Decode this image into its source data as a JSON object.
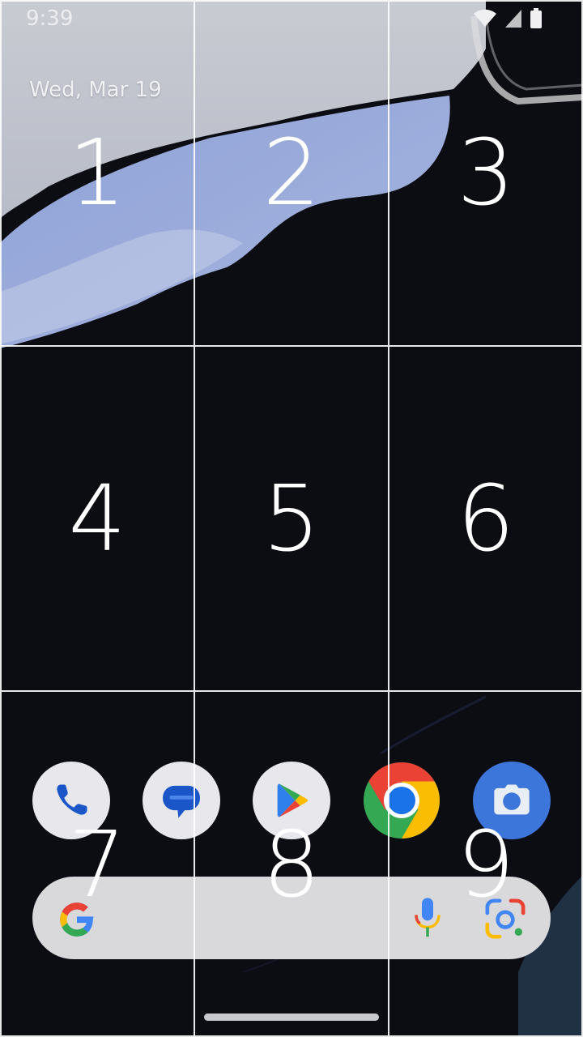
{
  "status_bar": {
    "time": "9:39",
    "icons": [
      "wifi-icon",
      "cell-signal-icon",
      "battery-icon"
    ]
  },
  "date_widget": {
    "date": "Wed, Mar 19"
  },
  "grid_labels": [
    "1",
    "2",
    "3",
    "4",
    "5",
    "6",
    "7",
    "8",
    "9"
  ],
  "dock": {
    "apps": [
      {
        "name": "phone-app-icon"
      },
      {
        "name": "messages-app-icon"
      },
      {
        "name": "play-store-app-icon"
      },
      {
        "name": "chrome-app-icon"
      },
      {
        "name": "camera-app-icon"
      }
    ]
  },
  "search_bar": {
    "icons": [
      "google-g-icon",
      "microphone-icon",
      "google-lens-icon"
    ]
  },
  "colors": {
    "wallpaper_dark": "#0d0d14",
    "grid_line": "#ffffff",
    "search_bg": "#d9d9dc"
  }
}
